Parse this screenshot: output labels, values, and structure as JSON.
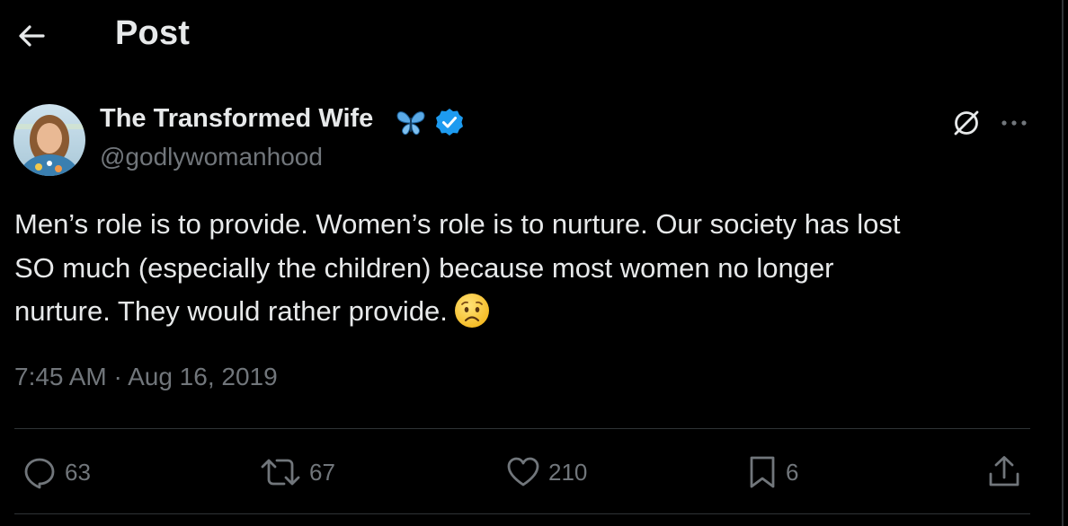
{
  "header": {
    "title": "Post"
  },
  "author": {
    "display_name": "The Transformed Wife",
    "handle": "@godlywomanhood",
    "verified": true,
    "name_emoji": "butterfly-icon"
  },
  "tweet": {
    "lines": [
      "Men’s role is to provide. Women’s role is to nurture. Our society has lost",
      "SO much (especially the children) because most women no longer",
      "nurture. They would rather provide."
    ],
    "trailing_emoji": "worried-face-emoji",
    "timestamp": "7:45 AM · Aug 16, 2019"
  },
  "actions": {
    "replies": "63",
    "reposts": "67",
    "likes": "210",
    "bookmarks": "6"
  },
  "colors": {
    "background": "#000000",
    "text": "#e7e9ea",
    "secondary": "#71767b",
    "border": "#2f3336",
    "verified_blue": "#1d9bf0"
  }
}
